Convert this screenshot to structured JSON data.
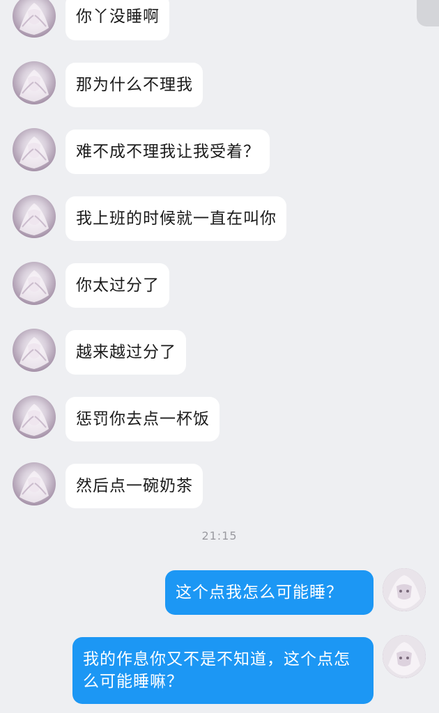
{
  "incoming_messages": [
    "你丫没睡啊",
    "那为什么不理我",
    "难不成不理我让我受着？",
    "我上班的时候就一直在叫你",
    "你太过分了",
    "越来越过分了",
    "惩罚你去点一杯饭",
    "然后点一碗奶茶"
  ],
  "timestamp": "21:15",
  "outgoing_messages": [
    "这个点我怎么可能睡？",
    "我的作息你又不是不知道，这个点怎么可能睡嘛？"
  ],
  "colors": {
    "background": "#eeeff2",
    "incoming_bubble": "#ffffff",
    "outgoing_bubble": "#1c97f4"
  }
}
